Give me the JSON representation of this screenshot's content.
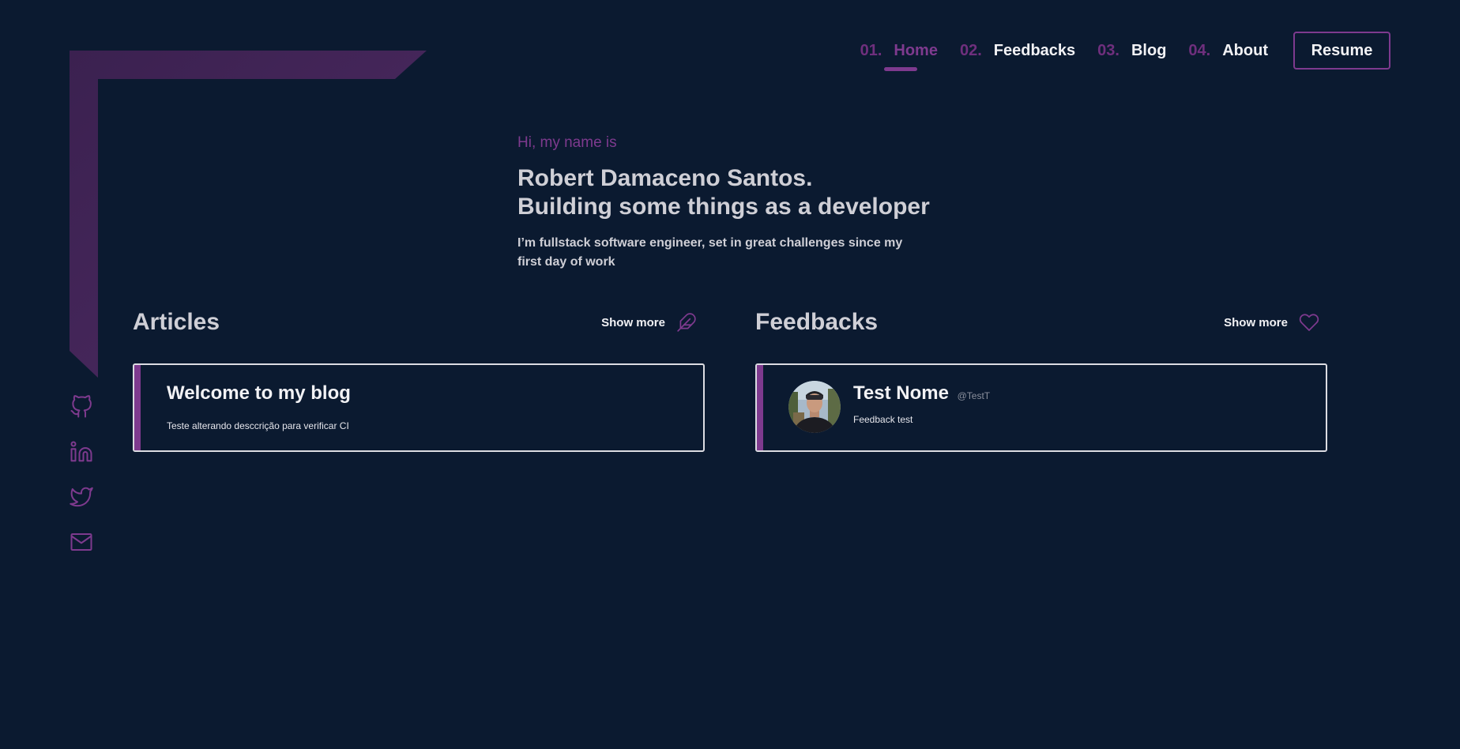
{
  "colors": {
    "background": "#0b1a30",
    "accent": "#7e3a8e",
    "accent_dim": "#6f2f7d",
    "text_light": "#f2f2f5",
    "text_muted": "#cfcfd6"
  },
  "nav": {
    "items": [
      {
        "number": "01.",
        "label": "Home",
        "active": true
      },
      {
        "number": "02.",
        "label": "Feedbacks",
        "active": false
      },
      {
        "number": "03.",
        "label": "Blog",
        "active": false
      },
      {
        "number": "04.",
        "label": "About",
        "active": false
      }
    ],
    "resume_label": "Resume"
  },
  "hero": {
    "greeting": "Hi, my name is",
    "title_line1": "Robert Damaceno Santos.",
    "title_line2": "Building some things as a developer",
    "description": "I’m fullstack software engineer, set in great challenges since my first day of work"
  },
  "social": {
    "icons": [
      "github-icon",
      "linkedin-icon",
      "twitter-icon",
      "mail-icon"
    ]
  },
  "articles": {
    "title": "Articles",
    "show_more": "Show more",
    "icon": "feather-icon",
    "items": [
      {
        "title": "Welcome to my blog",
        "description": "Teste alterando desccrição para verificar CI"
      }
    ]
  },
  "feedbacks": {
    "title": "Feedbacks",
    "show_more": "Show more",
    "icon": "heart-icon",
    "items": [
      {
        "name": "Test Nome",
        "handle": "@TestT",
        "text": "Feedback test"
      }
    ]
  }
}
